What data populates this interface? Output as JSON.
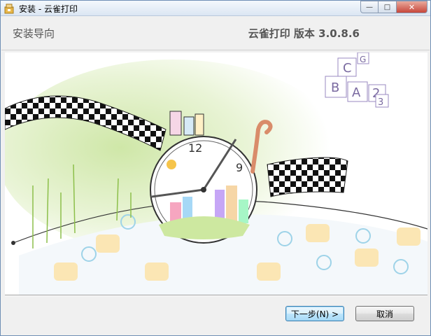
{
  "window": {
    "title": "安装 - 云雀打印",
    "caption_buttons": {
      "minimize": "—",
      "maximize": "□",
      "close": "✕"
    }
  },
  "header": {
    "title": "安装导向",
    "version": "云雀打印 版本 3.0.8.6"
  },
  "illustration": {
    "description_icon": "wizard-illustration",
    "clock_numbers": [
      "12",
      "9"
    ],
    "blocks_letters": [
      "B",
      "A",
      "C",
      "2",
      "3",
      "G"
    ]
  },
  "buttons": {
    "next": "下一步(N) >",
    "cancel": "取消"
  },
  "colors": {
    "accent": "#3c7fb1",
    "close": "#c7463a"
  }
}
